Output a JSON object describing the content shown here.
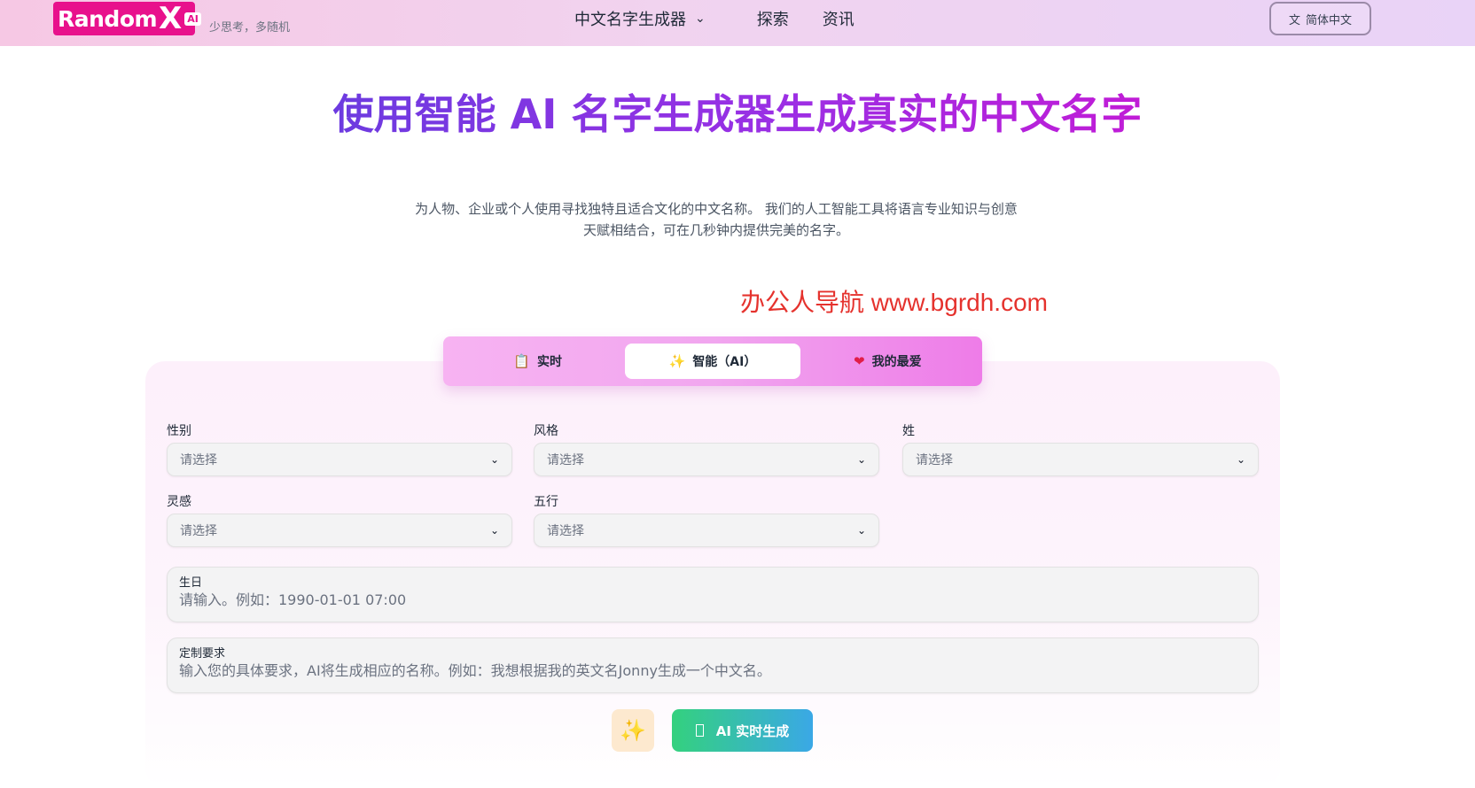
{
  "header": {
    "logo_text": "Random",
    "logo_x": "X",
    "logo_badge": "AI",
    "slogan": "少思考，多随机",
    "nav": [
      {
        "label": "中文名字生成器"
      },
      {
        "label": "探索"
      },
      {
        "label": "资讯"
      }
    ],
    "language": "简体中文"
  },
  "hero": {
    "title": "使用智能 AI 名字生成器生成真实的中文名字",
    "subtitle": "为人物、企业或个人使用寻找独特且适合文化的中文名称。 我们的人工智能工具将语言专业知识与创意天赋相结合，可在几秒钟内提供完美的名字。"
  },
  "watermark": "办公人导航 www.bgrdh.com",
  "tabs": [
    {
      "label": "实时",
      "icon": "clipboard-icon"
    },
    {
      "label": "智能（AI）",
      "icon": "sparkle-wand-icon",
      "active": true
    },
    {
      "label": "我的最爱",
      "icon": "heart-icon"
    }
  ],
  "form": {
    "gender": {
      "label": "性别",
      "placeholder": "请选择"
    },
    "style": {
      "label": "风格",
      "placeholder": "请选择"
    },
    "surname": {
      "label": "姓",
      "placeholder": "请选择"
    },
    "inspiration": {
      "label": "灵感",
      "placeholder": "请选择"
    },
    "five_elements": {
      "label": "五行",
      "placeholder": "请选择"
    },
    "birthday": {
      "label": "生日",
      "placeholder": "请输入。例如：1990-01-01 07:00"
    },
    "custom": {
      "label": "定制要求",
      "placeholder": "输入您的具体要求，AI将生成相应的名称。例如：我想根据我的英文名Jonny生成一个中文名。"
    }
  },
  "actions": {
    "generate_label": "AI 实时生成"
  },
  "colors": {
    "brand_pink": "#e8118c",
    "title_gradient_start": "#6b3be0",
    "title_gradient_end": "#c21bd6",
    "watermark_red": "#e5322d",
    "generate_gradient_start": "#34d17e",
    "generate_gradient_end": "#3aa8e6"
  }
}
